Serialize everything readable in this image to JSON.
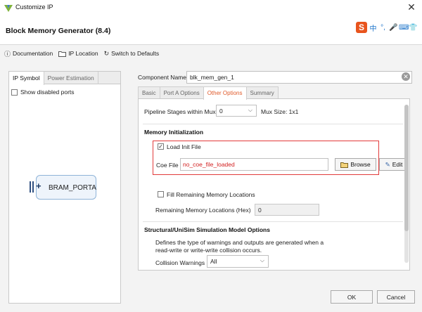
{
  "window": {
    "title": "Customize IP"
  },
  "header": {
    "title": "Block Memory Generator (8.4)"
  },
  "ime_bar": {
    "logo": "S",
    "items": [
      "中",
      "°,",
      "🎤",
      "⌨",
      "👕"
    ]
  },
  "toolbar": {
    "documentation": "Documentation",
    "ip_location": "IP Location",
    "switch_defaults": "Switch to Defaults"
  },
  "left_panel": {
    "tabs": [
      "IP Symbol",
      "Power Estimation"
    ],
    "show_disabled_ports": "Show disabled ports",
    "symbol_label": "BRAM_PORTA"
  },
  "component": {
    "label": "Component Name",
    "value": "blk_mem_gen_1"
  },
  "tabs": [
    "Basic",
    "Port A Options",
    "Other Options",
    "Summary"
  ],
  "other_options": {
    "pipeline_label": "Pipeline Stages within Mux",
    "pipeline_value": "0",
    "mux_size": "Mux Size: 1x1",
    "memory_init_title": "Memory Initialization",
    "load_init_file": "Load Init File",
    "load_init_checked": "✓",
    "coe_label": "Coe File",
    "coe_value": "no_coe_file_loaded",
    "browse": "Browse",
    "edit": "Edit",
    "fill_remaining": "Fill Remaining Memory Locations",
    "remaining_label": "Remaining Memory Locations (Hex)",
    "remaining_value": "0",
    "sim_title": "Structural/UniSim Simulation Model Options",
    "sim_desc_1": "Defines the type of warnings and outputs are generated when a",
    "sim_desc_2": "read-write or write-write collision occurs.",
    "collision_label": "Collision Warnings",
    "collision_value": "All"
  },
  "footer": {
    "ok": "OK",
    "cancel": "Cancel"
  }
}
